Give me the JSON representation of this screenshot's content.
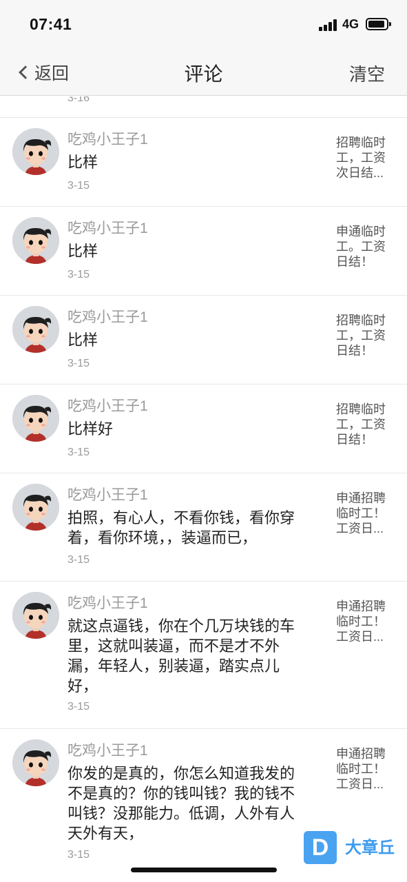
{
  "status_bar": {
    "time": "07:41",
    "network": "4G",
    "icons": [
      "signal-bars-icon",
      "battery-icon"
    ]
  },
  "nav": {
    "back_label": "返回",
    "back_icon": "chevron-left-icon",
    "title": "评论",
    "clear_label": "清空"
  },
  "partial_date": "3-16",
  "comments": [
    {
      "name": "吃鸡小王子1",
      "content": "比样",
      "date": "3-15",
      "ref": "招聘临时工，工资次日结..."
    },
    {
      "name": "吃鸡小王子1",
      "content": "比样",
      "date": "3-15",
      "ref": "申通临时工。工资日结！"
    },
    {
      "name": "吃鸡小王子1",
      "content": "比样",
      "date": "3-15",
      "ref": "招聘临时工，工资日结！"
    },
    {
      "name": "吃鸡小王子1",
      "content": "比样好",
      "date": "3-15",
      "ref": "招聘临时工，工资日结！"
    },
    {
      "name": "吃鸡小王子1",
      "content": "拍照，有心人，不看你钱，看你穿着，看你环境，，装逼而已，",
      "date": "3-15",
      "ref": "申通招聘临时工！工资日..."
    },
    {
      "name": "吃鸡小王子1",
      "content": "就这点逼钱，你在个几万块钱的车里，这就叫装逼，而不是才不外漏，年轻人，别装逼，踏实点儿好，",
      "date": "3-15",
      "ref": "申通招聘临时工！工资日..."
    },
    {
      "name": "吃鸡小王子1",
      "content": "你发的是真的，你怎么知道我发的不是真的？你的钱叫钱？我的钱不叫钱？没那能力。低调，人外有人天外有天，",
      "date": "3-15",
      "ref": "申通招聘临时工！工资日..."
    }
  ],
  "watermark": {
    "icon_letter": "D",
    "text": "大章丘"
  },
  "colors": {
    "nav_bg": "#f7f7f7",
    "meta_gray": "#9a9a9a",
    "watermark_blue": "#4aa3f0"
  }
}
